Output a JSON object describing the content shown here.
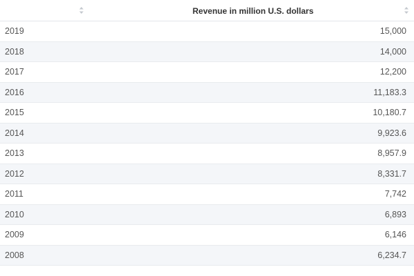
{
  "table": {
    "columns": [
      "",
      "Revenue in million U.S. dollars"
    ],
    "sort_icon": "sort-arrows-icon",
    "rows": [
      {
        "year": "2019",
        "value": "15,000"
      },
      {
        "year": "2018",
        "value": "14,000"
      },
      {
        "year": "2017",
        "value": "12,200"
      },
      {
        "year": "2016",
        "value": "11,183.3"
      },
      {
        "year": "2015",
        "value": "10,180.7"
      },
      {
        "year": "2014",
        "value": "9,923.6"
      },
      {
        "year": "2013",
        "value": "8,957.9"
      },
      {
        "year": "2012",
        "value": "8,331.7"
      },
      {
        "year": "2011",
        "value": "7,742"
      },
      {
        "year": "2010",
        "value": "6,893"
      },
      {
        "year": "2009",
        "value": "6,146"
      },
      {
        "year": "2008",
        "value": "6,234.7"
      }
    ]
  },
  "chart_data": {
    "type": "table",
    "title": "",
    "xlabel": "",
    "ylabel": "Revenue in million U.S. dollars",
    "categories": [
      "2019",
      "2018",
      "2017",
      "2016",
      "2015",
      "2014",
      "2013",
      "2012",
      "2011",
      "2010",
      "2009",
      "2008"
    ],
    "series": [
      {
        "name": "Revenue in million U.S. dollars",
        "values": [
          15000,
          14000,
          12200,
          11183.3,
          10180.7,
          9923.6,
          8957.9,
          8331.7,
          7742,
          6893,
          6146,
          6234.7
        ]
      }
    ]
  },
  "colors": {
    "header_text": "#333333",
    "row_alt_bg": "#f4f6f9",
    "border": "#e8ebee",
    "sort_icon": "#c4c9cf"
  }
}
